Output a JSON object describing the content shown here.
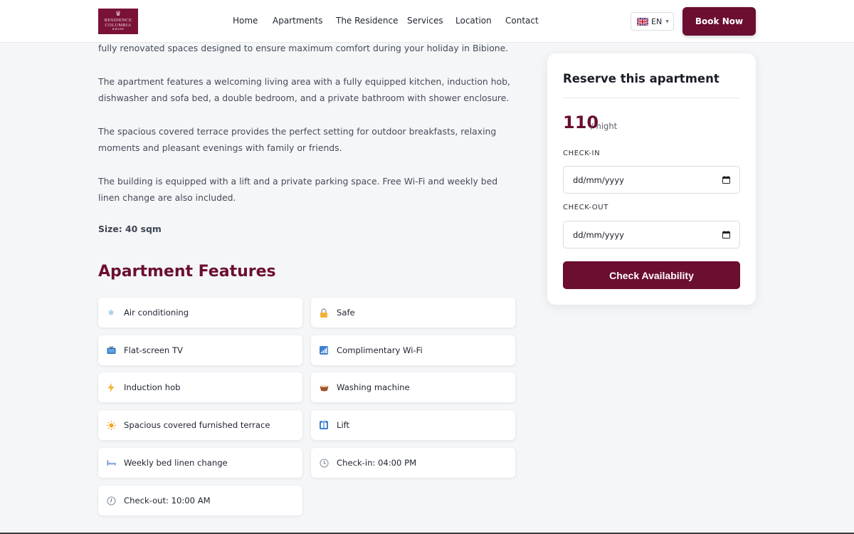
{
  "header": {
    "logo": {
      "line1": "RESIDENCE",
      "line2": "COLUMBIA",
      "line3": "BIBIONE"
    },
    "nav": [
      {
        "label": "Home"
      },
      {
        "label": "Apartments"
      },
      {
        "label": "The Residence"
      },
      {
        "label": "Services"
      },
      {
        "label": "Location"
      },
      {
        "label": "Contact"
      }
    ],
    "language": {
      "code": "EN",
      "flag_icon": "uk-flag-icon"
    },
    "book_now_label": "Book Now"
  },
  "description": {
    "paragraphs": [
      "fully renovated spaces designed to ensure maximum comfort during your holiday in Bibione.",
      "The apartment features a welcoming living area with a fully equipped kitchen, induction hob, dishwasher and sofa bed, a double bedroom, and a private bathroom with shower enclosure.",
      "The spacious covered terrace provides the perfect setting for outdoor breakfasts, relaxing moments and pleasant evenings with family or friends.",
      "The building is equipped with a lift and a private parking space. Free Wi-Fi and weekly bed linen change are also included."
    ],
    "size_text": "Size: 40 sqm"
  },
  "features": {
    "title": "Apartment Features",
    "items": [
      {
        "label": "Air conditioning",
        "icon": "snowflake-icon"
      },
      {
        "label": "Safe",
        "icon": "lock-icon"
      },
      {
        "label": "Flat-screen TV",
        "icon": "tv-icon"
      },
      {
        "label": "Complimentary Wi-Fi",
        "icon": "signal-bars-icon"
      },
      {
        "label": "Induction hob",
        "icon": "lightning-icon"
      },
      {
        "label": "Washing machine",
        "icon": "washing-bowl-icon"
      },
      {
        "label": "Spacious covered furnished terrace",
        "icon": "sun-icon"
      },
      {
        "label": "Lift",
        "icon": "elevator-icon"
      },
      {
        "label": "Weekly bed linen change",
        "icon": "bed-icon"
      },
      {
        "label": "Check-in: 04:00 PM",
        "icon": "clock-icon"
      },
      {
        "label": "Check-out: 10:00 AM",
        "icon": "clock-icon"
      }
    ]
  },
  "booking": {
    "title": "Reserve this apartment",
    "price": "110",
    "per_night": "/ night",
    "checkin_label": "CHECK-IN",
    "checkin_value": "dd/mm/yyyy",
    "checkout_label": "CHECK-OUT",
    "checkout_value": "dd/mm/yyyy",
    "button_label": "Check Availability"
  },
  "colors": {
    "brand": "#6b0e31",
    "background": "#f5f6f8"
  }
}
